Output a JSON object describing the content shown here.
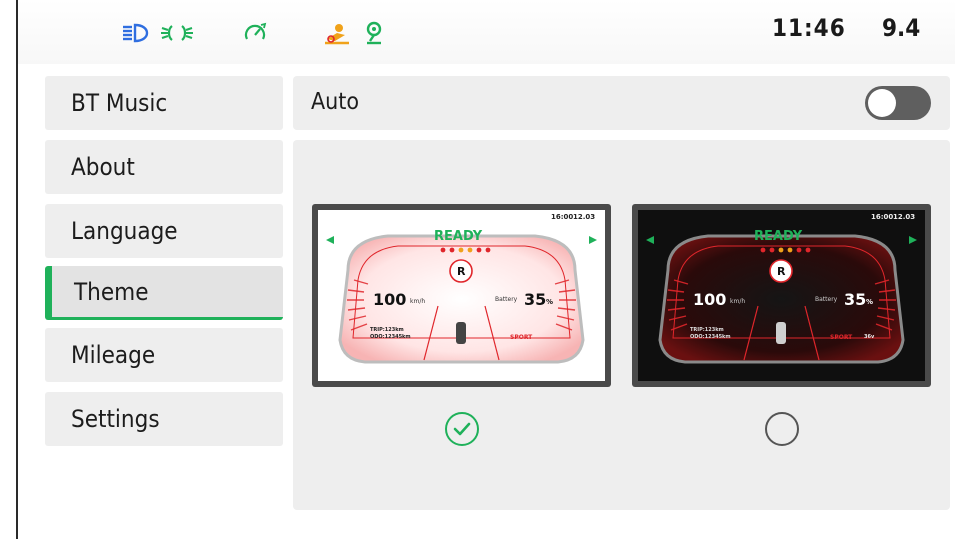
{
  "status_bar": {
    "icons": [
      {
        "name": "low-beam-icon",
        "color": "#2f6ee0"
      },
      {
        "name": "side-light-icon",
        "color": "#1fb15a"
      },
      {
        "name": "cruise-control-icon",
        "color": "#1fb15a"
      },
      {
        "name": "engine-mode-icon",
        "color": "#f0a21a"
      },
      {
        "name": "kickstand-icon",
        "color": "#1fb15a"
      }
    ],
    "time": "11:46",
    "odometer": "9.4"
  },
  "sidebar": {
    "items": [
      {
        "label": "BT Music"
      },
      {
        "label": "About"
      },
      {
        "label": "Language"
      },
      {
        "label": "Theme",
        "active": true
      },
      {
        "label": "Mileage"
      },
      {
        "label": "Settings"
      }
    ]
  },
  "auto_row": {
    "label": "Auto",
    "toggle_on": false
  },
  "themes": {
    "selected": "light",
    "options": [
      {
        "id": "light",
        "preview": {
          "time": "16:00",
          "value": "12.03",
          "ready": "READY",
          "gear": "R",
          "speed": "100",
          "speed_unit": "km/h",
          "battery_label": "Battery",
          "battery": "35",
          "battery_unit": "%",
          "trip": "TRIP:123km",
          "odo": "ODO:12345km",
          "mode": "SPORT"
        }
      },
      {
        "id": "dark",
        "preview": {
          "time": "16:00",
          "value": "12.03",
          "ready": "READY",
          "gear": "R",
          "speed": "100",
          "speed_unit": "km/h",
          "battery_label": "Battery",
          "battery": "35",
          "battery_unit": "%",
          "trip": "TRIP:123km",
          "odo": "ODO:12345km",
          "mode": "SPORT",
          "temp": "36v"
        }
      }
    ]
  },
  "colors": {
    "accent_green": "#1fb15a",
    "gauge_red": "#e0262b"
  }
}
